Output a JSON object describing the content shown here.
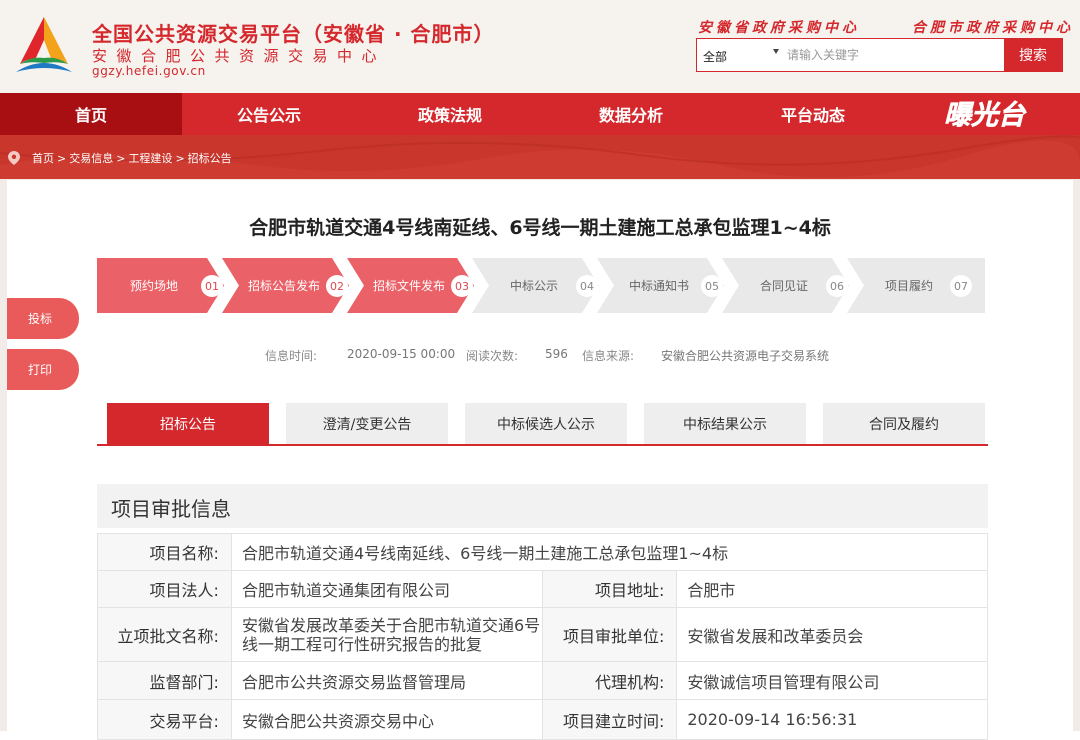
{
  "header": {
    "title": "全国公共资源交易平台（安徽省 · 合肥市）",
    "subtitle": "安徽合肥公共资源交易中心",
    "url": "ggzy.hefei.gov.cn",
    "link_left": "安徽省政府采购中心",
    "link_right": "合肥市政府采购中心",
    "search_select_value": "全部",
    "search_placeholder": "请输入关键字",
    "search_button": "搜索",
    "brand_color": "#d4282d"
  },
  "nav": {
    "items": [
      "首页",
      "公告公示",
      "政策法规",
      "数据分析",
      "平台动态"
    ],
    "active_index": 0,
    "logo_text": "曝光台"
  },
  "breadcrumb": [
    "首页",
    "交易信息",
    "工程建设",
    "招标公告"
  ],
  "page_title": "合肥市轨道交通4号线南延线、6号线一期土建施工总承包监理1~4标",
  "steps": [
    {
      "label": "预约场地",
      "num": "01",
      "done": true
    },
    {
      "label": "招标公告发布",
      "num": "02",
      "done": true
    },
    {
      "label": "招标文件发布",
      "num": "03",
      "done": true
    },
    {
      "label": "中标公示",
      "num": "04",
      "done": false
    },
    {
      "label": "中标通知书",
      "num": "05",
      "done": false
    },
    {
      "label": "合同见证",
      "num": "06",
      "done": false
    },
    {
      "label": "项目履约",
      "num": "07",
      "done": false
    }
  ],
  "side_buttons": {
    "bid": "投标",
    "print": "打印"
  },
  "meta": {
    "time_label": "信息时间:",
    "time_value": "2020-09-15 00:00",
    "reads_label": "阅读次数:",
    "reads_value": "596",
    "source_label": "信息来源:",
    "source_value": "安徽合肥公共资源电子交易系统"
  },
  "tabs": [
    "招标公告",
    "澄清/变更公告",
    "中标候选人公示",
    "中标结果公示",
    "合同及履约"
  ],
  "active_tab": 0,
  "section": {
    "title": "项目审批信息"
  },
  "info": {
    "project_name_label": "项目名称:",
    "project_name": "合肥市轨道交通4号线南延线、6号线一期土建施工总承包监理1~4标",
    "legal_label": "项目法人:",
    "legal": "合肥市轨道交通集团有限公司",
    "address_label": "项目地址:",
    "address": "合肥市",
    "approval_doc_label": "立项批文名称:",
    "approval_doc": "安徽省发展改革委关于合肥市轨道交通6号线一期工程可行性研究报告的批复",
    "approval_unit_label": "项目审批单位:",
    "approval_unit": "安徽省发展和改革委员会",
    "supervisor_label": "监督部门:",
    "supervisor": "合肥市公共资源交易监督管理局",
    "agency_label": "代理机构:",
    "agency": "安徽诚信项目管理有限公司",
    "platform_label": "交易平台:",
    "platform": "安徽合肥公共资源交易中心",
    "created_label": "项目建立时间:",
    "created": "2020-09-14 16:56:31"
  }
}
